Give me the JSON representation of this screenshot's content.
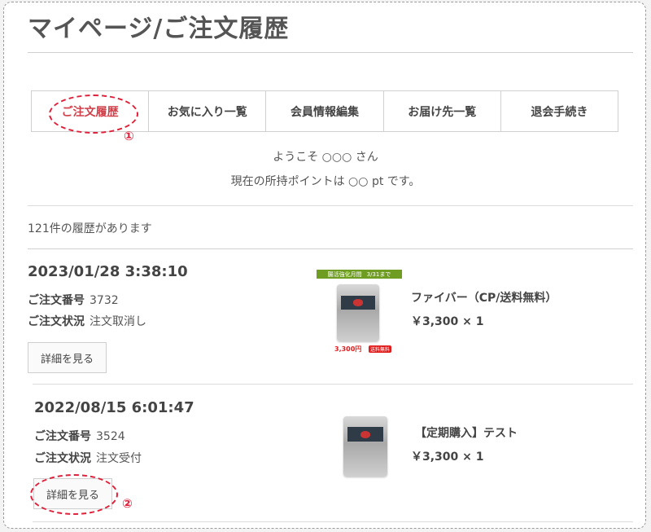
{
  "page": {
    "title": "マイページ/ご注文履歴"
  },
  "tabs": [
    {
      "label": "ご注文履歴"
    },
    {
      "label": "お気に入り一覧"
    },
    {
      "label": "会員情報編集"
    },
    {
      "label": "お届け先一覧"
    },
    {
      "label": "退会手続き"
    }
  ],
  "markers": {
    "one": "①",
    "two": "②"
  },
  "welcome": {
    "greeting": "ようこそ ○○○ さん",
    "points": "現在の所持ポイントは ○○ pt です。"
  },
  "history": {
    "count_text": "121件の履歴があります"
  },
  "labels": {
    "order_number": "ご注文番号",
    "order_status": "ご注文状況"
  },
  "orders": [
    {
      "date": "2023/01/28 3:38:10",
      "number": "3732",
      "status": "注文取消し",
      "detail_label": "詳細を見る",
      "product_name": "ファイバー（CP/送料無料）",
      "price_qty": "￥3,300 × 1",
      "thumb": {
        "banner_left": "腸活強化月間",
        "banner_right": "3/31まで",
        "price": "3,300円",
        "shipping": "送料無料"
      }
    },
    {
      "date": "2022/08/15 6:01:47",
      "number": "3524",
      "status": "注文受付",
      "detail_label": "詳細を見る",
      "product_name": "【定期購入】テスト",
      "price_qty": "￥3,300 × 1"
    }
  ],
  "colors": {
    "accent": "#e0203a",
    "active_tab": "#d0404a",
    "promo": "#6f9d22"
  }
}
